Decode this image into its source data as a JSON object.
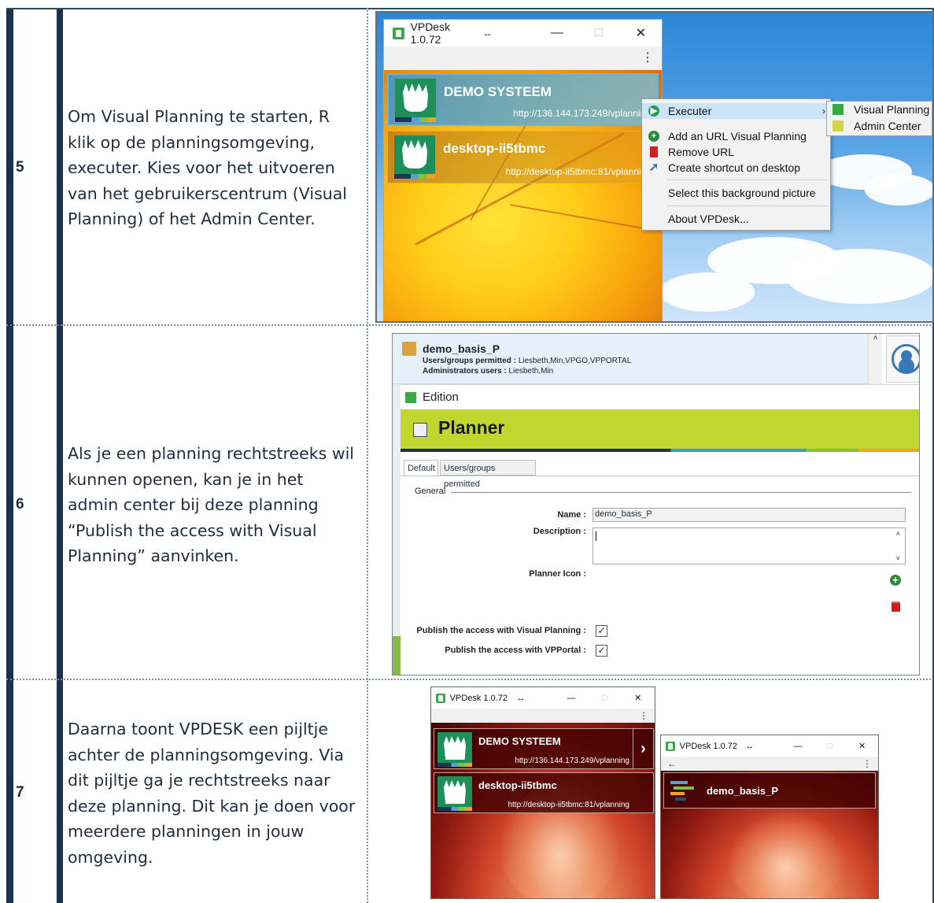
{
  "rows": [
    {
      "number": "5",
      "text": "Om Visual Planning te starten, R klik op de planningsomgeving, executer. Kies voor het uitvoeren van het gebruikerscentrum (Visual Planning) of het Admin Center."
    },
    {
      "number": "6",
      "text": "Als je een planning rechtstreeks wil kunnen openen, kan je in het admin center bij deze planning “Publish the access with Visual Planning” aanvinken."
    },
    {
      "number": "7",
      "text": "Daarna toont VPDESK een pijltje achter de planningsomgeving. Via dit pijltje ga je rechtstreeks naar deze planning. Dit kan je doen voor meerdere planningen in jouw omgeving."
    }
  ],
  "shot5": {
    "window_title": "VPDesk 1.0.72",
    "resize_glyph": "↔",
    "min_glyph": "—",
    "max_glyph": "□",
    "close_glyph": "✕",
    "menu_glyph": "⋮",
    "plannings": [
      {
        "name": "DEMO SYSTEEM",
        "url": "http://136.144.173.249/vplanning"
      },
      {
        "name": "desktop-ii5tbmc",
        "url": "http://desktop-ii5tbmc:81/vplanning"
      }
    ],
    "context_menu": {
      "executer": "Executer",
      "add_url": "Add an URL Visual Planning",
      "remove_url": "Remove URL",
      "create_shortcut": "Create shortcut on desktop",
      "select_background": "Select this background picture",
      "about": "About VPDesk..."
    },
    "submenu": {
      "visual_planning": "Visual Planning",
      "admin_center": "Admin Center"
    }
  },
  "shot6": {
    "planning_name": "demo_basis_P",
    "users_label": "Users/groups permitted :",
    "users_value": "Liesbeth,Min,VPGO,VPPORTAL",
    "admins_label": "Administrators users :",
    "admins_value": "Liesbeth,Min",
    "edition_label": "Edition",
    "planner_title": "Planner",
    "tab_default": "Default",
    "tab_users": "Users/groups permitted",
    "group_general": "General",
    "name_label": "Name :",
    "name_value": "demo_basis_P",
    "description_label": "Description :",
    "planner_icon_label": "Planner Icon :",
    "publish_vp_label": "Publish the access with Visual Planning :",
    "publish_vpportal_label": "Publish the access with VPPortal :",
    "check_glyph": "✓",
    "scroll_up": "˄",
    "scroll_down": "˅"
  },
  "shot7": {
    "window_title": "VPDesk 1.0.72",
    "resize_glyph": "↔",
    "min_glyph": "—",
    "max_glyph": "□",
    "close_glyph": "✕",
    "menu_glyph": "⋮",
    "back_glyph": "←",
    "arrow_glyph": "›",
    "plannings": [
      {
        "name": "DEMO SYSTEEM",
        "url": "http://136.144.173.249/vplanning"
      },
      {
        "name": "desktop-ii5tbmc",
        "url": "http://desktop-ii5tbmc:81/vplanning"
      }
    ],
    "direct_planning": "demo_basis_P"
  }
}
